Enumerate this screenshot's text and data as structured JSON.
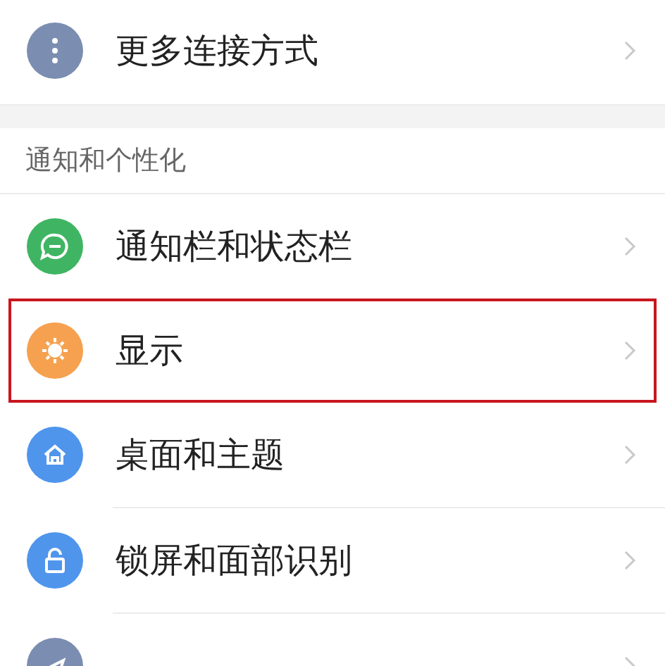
{
  "top_items": [
    {
      "label": "更多连接方式",
      "color": "#7b8db0",
      "selected": false
    }
  ],
  "sections": [
    {
      "title": "通知和个性化",
      "items": [
        {
          "label": "通知栏和状态栏",
          "color": "#3fb563",
          "selected": false
        },
        {
          "label": "显示",
          "color": "#f5a14f",
          "selected": true
        },
        {
          "label": "桌面和主题",
          "color": "#4f95ec",
          "selected": false
        },
        {
          "label": "锁屏和面部识别",
          "color": "#4f95ec",
          "selected": false
        },
        {
          "color": "#7b8db0",
          "selected": false
        }
      ]
    }
  ]
}
